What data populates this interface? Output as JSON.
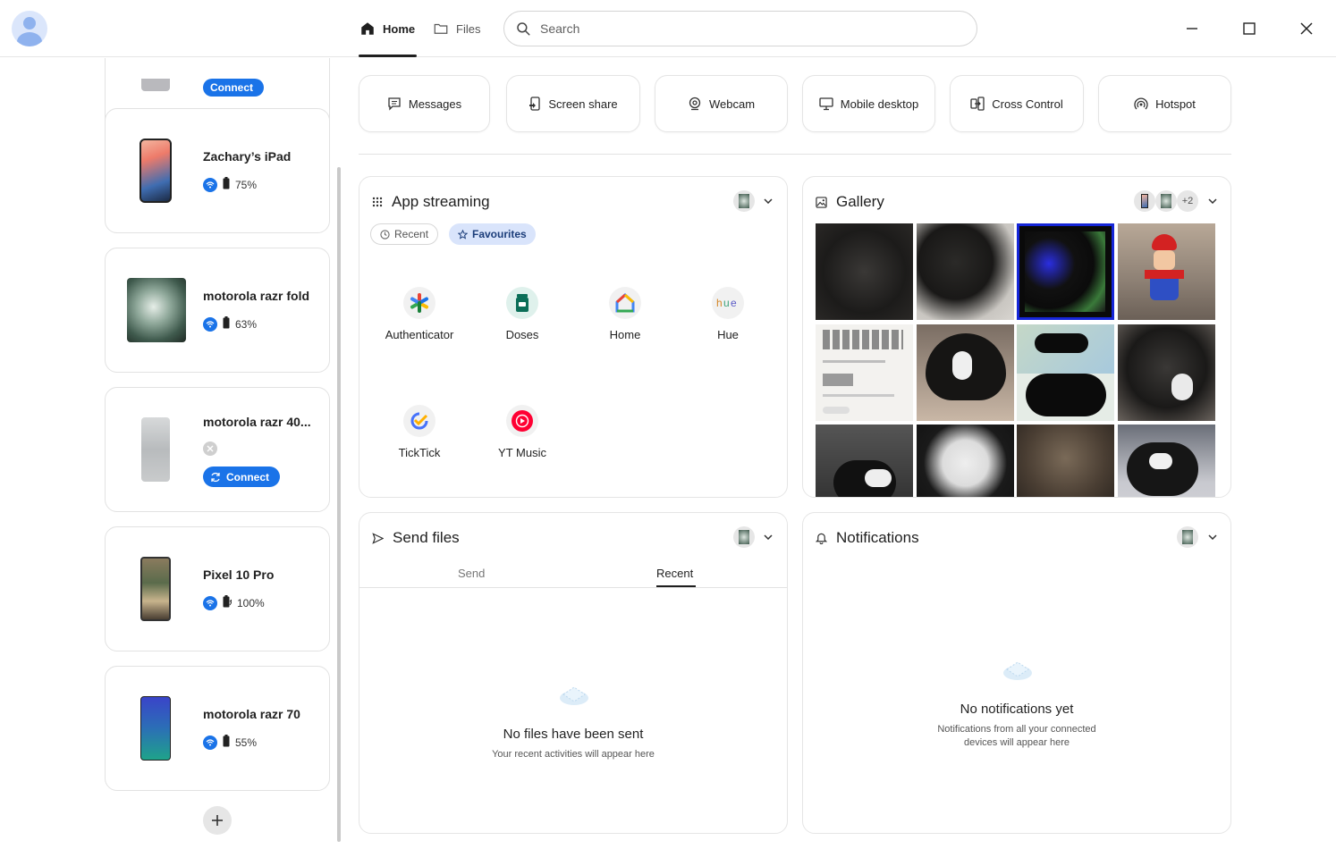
{
  "nav": {
    "home_label": "Home",
    "files_label": "Files",
    "search_placeholder": "Search"
  },
  "devices": [
    {
      "name": "",
      "status": "",
      "connect": "Connect"
    },
    {
      "name": "Zachary’s iPad",
      "battery": "75%",
      "connection": "wifi"
    },
    {
      "name": "motorola razr fold",
      "battery": "63%",
      "connection": "wifi"
    },
    {
      "name": "motorola razr 40...",
      "connection": "offline",
      "connect": "Connect"
    },
    {
      "name": "Pixel 10 Pro",
      "battery": "100%",
      "connection": "wifi",
      "charging": true
    },
    {
      "name": "motorola razr 70",
      "battery": "55%",
      "connection": "wifi"
    }
  ],
  "quick_actions": [
    "Messages",
    "Screen share",
    "Webcam",
    "Mobile desktop",
    "Cross Control",
    "Hotspot"
  ],
  "app_streaming": {
    "title": "App streaming",
    "chips": {
      "recent": "Recent",
      "favourites": "Favourites"
    },
    "apps": [
      "Authenticator",
      "Doses",
      "Home",
      "Hue",
      "TickTick",
      "YT Music"
    ]
  },
  "gallery": {
    "title": "Gallery",
    "more_count": "+2"
  },
  "send_files": {
    "title": "Send files",
    "tabs": {
      "send": "Send",
      "recent": "Recent"
    },
    "empty_title": "No files have been sent",
    "empty_sub": "Your recent activities will appear here"
  },
  "notifications": {
    "title": "Notifications",
    "empty_title": "No notifications yet",
    "empty_sub_1": "Notifications from all your connected",
    "empty_sub_2": "devices will appear here"
  },
  "colors": {
    "accent": "#1a73e8",
    "chip_bg": "#d9e4fb"
  }
}
